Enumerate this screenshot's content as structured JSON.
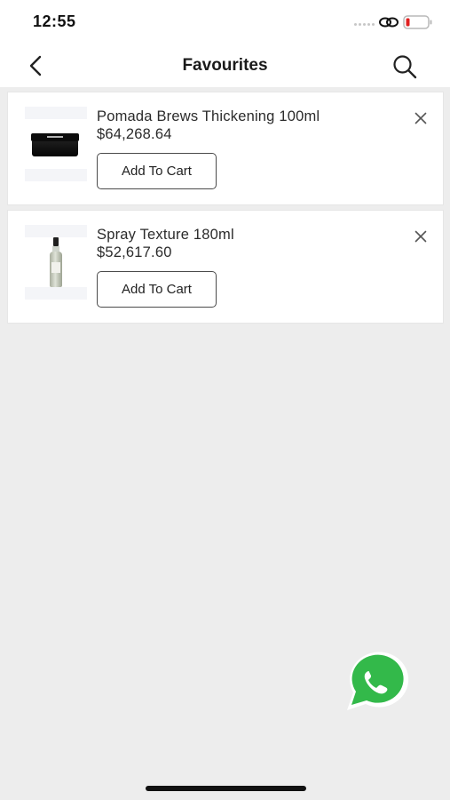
{
  "status_bar": {
    "time": "12:55"
  },
  "header": {
    "title": "Favourites"
  },
  "favourites": [
    {
      "name": "Pomada Brews Thickening 100ml",
      "price": "$64,268.64",
      "button_label": "Add To Cart"
    },
    {
      "name": "Spray Texture 180ml",
      "price": "$52,617.60",
      "button_label": "Add To Cart"
    }
  ],
  "icons": {
    "back": "chevron-left-icon",
    "search": "search-icon",
    "remove": "close-icon",
    "chat": "whatsapp-icon",
    "link": "link-icon",
    "battery": "battery-icon"
  },
  "colors": {
    "background": "#ededed",
    "card": "#ffffff",
    "whatsapp": "#33b94a",
    "battery_low": "#e02020"
  }
}
